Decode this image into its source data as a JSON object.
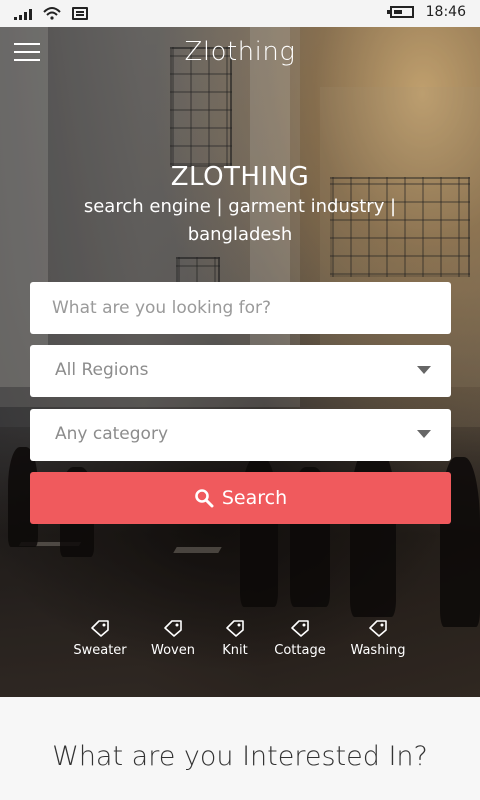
{
  "status_bar": {
    "time": "18:46"
  },
  "header": {
    "title": "Zlothing"
  },
  "hero": {
    "brand": "ZLOTHING",
    "tagline": "search engine | garment industry | bangladesh"
  },
  "search": {
    "placeholder": "What are you looking for?",
    "region_selected": "All Regions",
    "category_selected": "Any category",
    "button_label": "Search"
  },
  "tags": [
    "Sweater",
    "Woven",
    "Knit",
    "Cottage",
    "Washing"
  ],
  "section": {
    "title": "What are you Interested In?"
  },
  "colors": {
    "accent": "#f05a5d"
  }
}
